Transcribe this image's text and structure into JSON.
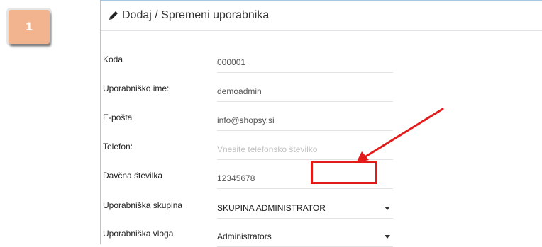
{
  "step": {
    "number": "1"
  },
  "panel": {
    "title": "Dodaj / Spremeni uporabnika"
  },
  "form": {
    "rows": [
      {
        "label": "Koda",
        "value": "000001"
      },
      {
        "label": "Uporabniško ime:",
        "value": "demoadmin"
      },
      {
        "label": "E-pošta",
        "value": "info@shopsy.si"
      },
      {
        "label": "Telefon:",
        "placeholder": "Vnesite telefonsko številko"
      },
      {
        "label": "Davčna številka",
        "value": "12345678"
      },
      {
        "label": "Uporabniška skupina",
        "value": "SKUPINA ADMINISTRATOR"
      },
      {
        "label": "Uporabniška vloga",
        "value": "Administrators"
      }
    ]
  },
  "colors": {
    "badge": "#f2b48f",
    "highlight": "#e21b1b",
    "panel_border": "#a9c7e3"
  },
  "icons": {
    "header": "pencil-icon",
    "dropdown": "caret-down-icon"
  }
}
